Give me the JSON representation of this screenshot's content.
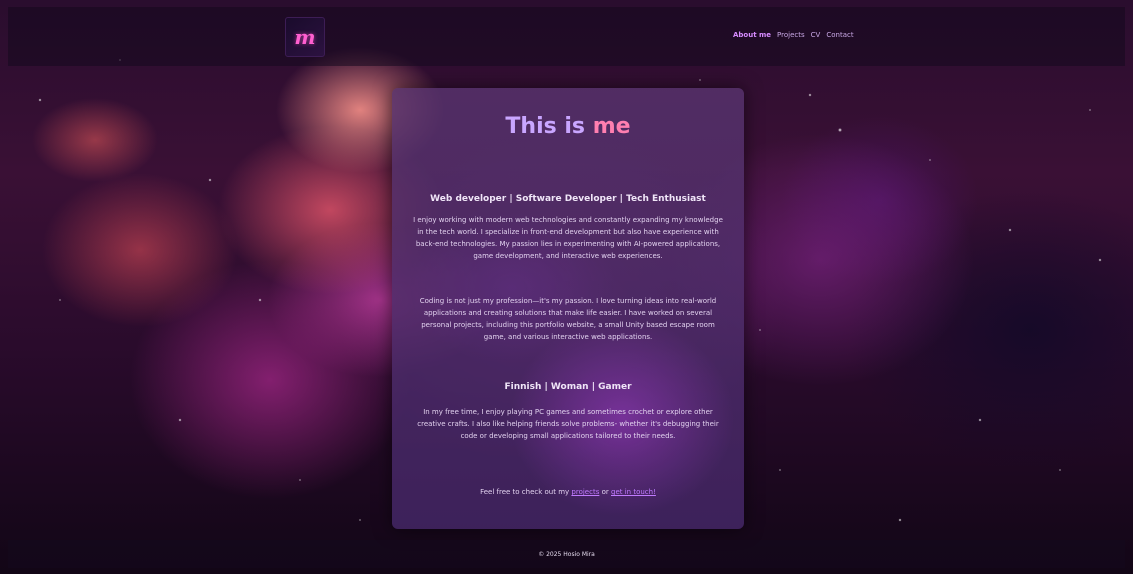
{
  "header": {
    "logo_glyph": "m",
    "nav": [
      "About me",
      "Projects",
      "CV",
      "Contact"
    ]
  },
  "main": {
    "title_part1": "This is",
    "title_part2": "me",
    "subhead1": "Web developer | Software Developer | Tech Enthusiast",
    "para1": "I enjoy working with modern web technologies and constantly expanding my knowledge in the tech world. I specialize in front-end development but also have experience with back-end technologies. My passion lies in experimenting with AI-powered applications, game development, and interactive web experiences.",
    "para2": "Coding is not just my profession—it's my passion. I love turning ideas into real-world applications and creating solutions that make life easier. I have worked on several personal projects, including this portfolio website, a small Unity based escape room game, and various interactive web applications.",
    "subhead2": "Finnish | Woman | Gamer",
    "para3": "In my free time, I enjoy playing PC games and sometimes crochet or explore other creative crafts. I also like helping friends solve problems- whether it's debugging their code or developing small applications tailored to their needs.",
    "cta_prefix": "Feel free to check out my",
    "cta_link1": "projects",
    "cta_mid": "or",
    "cta_link2": "get in touch!"
  },
  "footer": {
    "text": "© 2025 Hosio Mira"
  }
}
